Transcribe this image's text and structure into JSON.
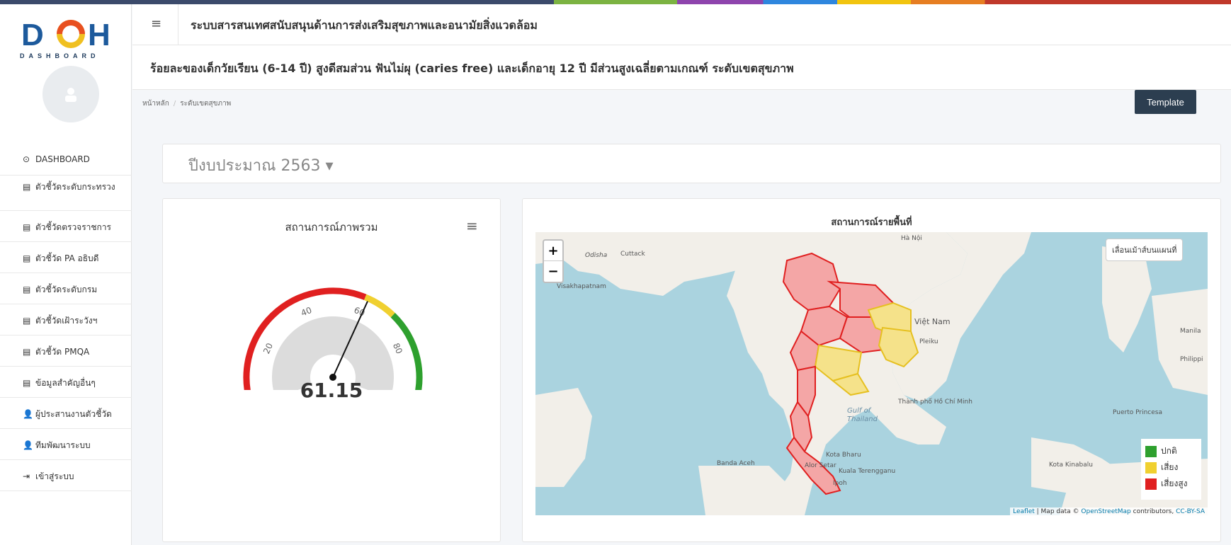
{
  "logo": {
    "text": "DOH",
    "sub": "DASHBOARD"
  },
  "header": {
    "system_title": "ระบบสารสนเทศสนับสนุนด้านการส่งเสริมสุขภาพและอนามัยสิ่งแวดล้อม",
    "page_title": "ร้อยละของเด็กวัยเรียน (6-14 ปี) สูงดีสมส่วน ฟันไม่ผุ (caries free) และเด็กอายุ 12 ปี มีส่วนสูงเฉลี่ยตามเกณฑ์ ระดับเขตสุขภาพ"
  },
  "breadcrumb": {
    "home": "หน้าหลัก",
    "current": "ระดับเขตสุขภาพ"
  },
  "template_label": "Template",
  "sidebar": {
    "items": [
      {
        "icon": "dashboard-icon",
        "glyph": "⊙",
        "label": "DASHBOARD"
      },
      {
        "icon": "list-icon",
        "glyph": "▤",
        "label": "ตัวชี้วัดระดับกระทรวง"
      },
      {
        "icon": "list-icon",
        "glyph": "▤",
        "label": "ตัวชี้วัดตรวจราชการ"
      },
      {
        "icon": "list-icon",
        "glyph": "▤",
        "label": "ตัวชี้วัด PA อธิบดี"
      },
      {
        "icon": "list-icon",
        "glyph": "▤",
        "label": "ตัวชี้วัดระดับกรม"
      },
      {
        "icon": "list-icon",
        "glyph": "▤",
        "label": "ตัวชี้วัดเฝ้าระวังฯ"
      },
      {
        "icon": "list-icon",
        "glyph": "▤",
        "label": "ตัวชี้วัด PMQA"
      },
      {
        "icon": "list-icon",
        "glyph": "▤",
        "label": "ข้อมูลสำคัญอื่นๆ"
      },
      {
        "icon": "user-icon",
        "glyph": "👤",
        "label": "ผู้ประสานงานตัวชี้วัด"
      },
      {
        "icon": "user-icon",
        "glyph": "👤",
        "label": "ทีมพัฒนาระบบ"
      },
      {
        "icon": "login-icon",
        "glyph": "⇥",
        "label": "เข้าสู่ระบบ"
      }
    ]
  },
  "year_selector": {
    "label": "ปีงบประมาณ 2563 ▾"
  },
  "gauge": {
    "title": "สถานการณ์ภาพรวม",
    "value": 61.15,
    "display": "61.15",
    "min": 0,
    "max": 100,
    "ticks": [
      "0",
      "20",
      "40",
      "60",
      "80",
      "100"
    ],
    "bands": [
      {
        "from": 0,
        "to": 60,
        "color": "#e02020"
      },
      {
        "from": 60,
        "to": 70,
        "color": "#f0d030"
      },
      {
        "from": 70,
        "to": 100,
        "color": "#2ea02e"
      }
    ]
  },
  "map": {
    "title": "สถานการณ์รายพื้นที่",
    "zoom_in": "+",
    "zoom_out": "−",
    "toggle_label": "เลื่อนเม้าส์บนแผนที่",
    "legend": [
      {
        "label": "ปกติ",
        "color": "#2ea02e"
      },
      {
        "label": "เสี่ยง",
        "color": "#f0d030"
      },
      {
        "label": "เสี่ยงสูง",
        "color": "#e02020"
      }
    ],
    "attribution": {
      "leaflet": "Leaflet",
      "data": " | Map data © ",
      "osm": "OpenStreetMap",
      "contrib": " contributors, ",
      "license": "CC-BY-SA"
    },
    "labels": [
      "Cuttack",
      "Odisha",
      "Visakhapatnam",
      "Hà Nội",
      "Việt Nam",
      "Pleiku",
      "Manila",
      "Thành phố Hồ Chí Minh",
      "Puerto Princesa",
      "Kota Bharu",
      "Banda Aceh",
      "Kuala Terengganu",
      "Kota Kinabalu",
      "Alor Setar",
      "Ipoh",
      "Gulf of Thailand",
      "Philippi"
    ]
  }
}
